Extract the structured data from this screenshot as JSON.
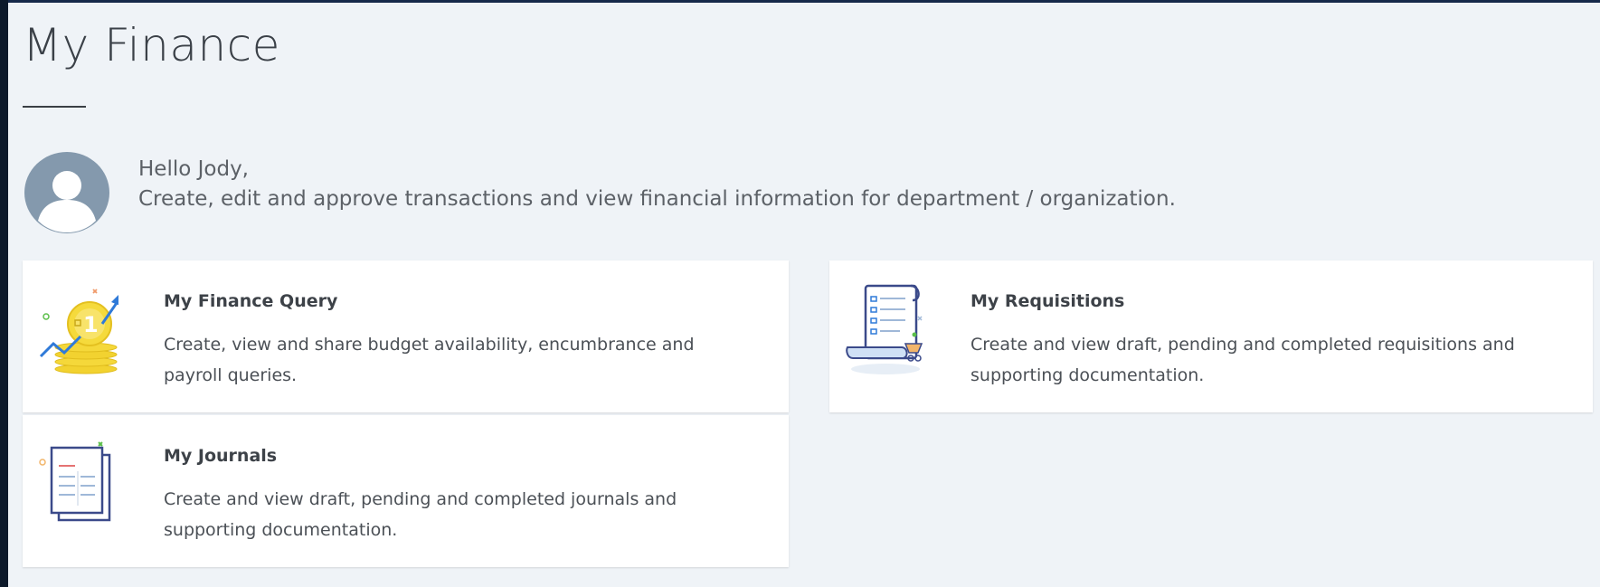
{
  "page": {
    "title": "My Finance",
    "greeting": "Hello Jody,",
    "subtitle": "Create, edit and approve transactions and view financial information for department / organization."
  },
  "cards": [
    {
      "title": "My Finance Query",
      "description": "Create, view and share budget availability, encumbrance and payroll queries.",
      "icon": "finance-query-icon"
    },
    {
      "title": "My Requisitions",
      "description": "Create and view draft, pending and completed requisitions and supporting documentation.",
      "icon": "requisitions-icon"
    },
    {
      "title": "My Journals",
      "description": "Create and view draft, pending and completed journals and supporting documentation.",
      "icon": "journals-icon"
    }
  ],
  "colors": {
    "page_bg": "#eff3f7",
    "card_bg": "#ffffff",
    "avatar": "#8499ad",
    "accent_gold": "#f2d230",
    "accent_blue": "#2f7ad8"
  }
}
